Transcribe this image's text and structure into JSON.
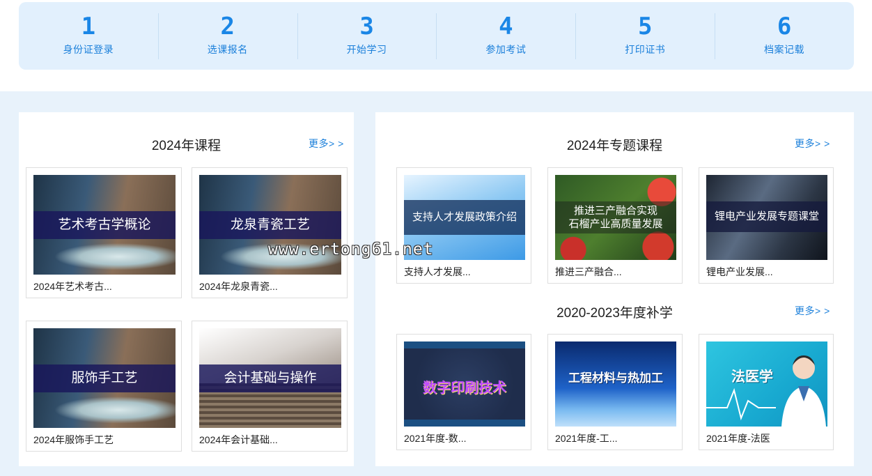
{
  "steps": [
    {
      "num": "1",
      "label": "身份证登录"
    },
    {
      "num": "2",
      "label": "选课报名"
    },
    {
      "num": "3",
      "label": "开始学习"
    },
    {
      "num": "4",
      "label": "参加考试"
    },
    {
      "num": "5",
      "label": "打印证书"
    },
    {
      "num": "6",
      "label": "档案记载"
    }
  ],
  "courses2024": {
    "title": "2024年课程",
    "more": "更多> >",
    "cards": [
      {
        "banner": "艺术考古学概论",
        "caption": "2024年艺术考古..."
      },
      {
        "banner": "龙泉青瓷工艺",
        "caption": "2024年龙泉青瓷..."
      },
      {
        "banner": "服饰手工艺",
        "caption": "2024年服饰手工艺"
      },
      {
        "banner": "会计基础与操作",
        "caption": "2024年会计基础..."
      }
    ]
  },
  "special2024": {
    "title": "2024年专题课程",
    "more": "更多> >",
    "cards": [
      {
        "banner": "支持人才发展政策介绍",
        "caption": "支持人才发展..."
      },
      {
        "banner_line1": "推进三产融合实现",
        "banner_line2": "石榴产业高质量发展",
        "caption": "推进三产融合..."
      },
      {
        "banner": "锂电产业发展专题课堂",
        "caption": "锂电产业发展..."
      }
    ]
  },
  "makeup": {
    "title": "2020-2023年度补学",
    "more": "更多> >",
    "cards": [
      {
        "image_text": "数字印刷技术",
        "caption": "2021年度-数..."
      },
      {
        "image_text": "工程材料与热加工",
        "caption": "2021年度-工..."
      },
      {
        "image_text": "法医学",
        "caption": "2021年度-法医"
      }
    ]
  },
  "watermark": "www.ertong61.net"
}
